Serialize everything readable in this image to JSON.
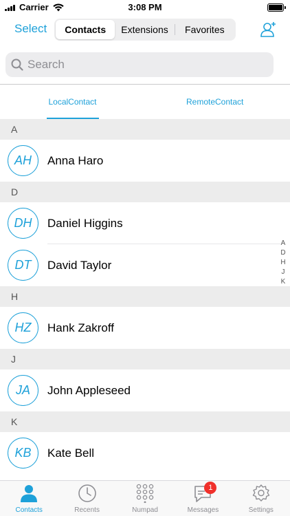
{
  "status_bar": {
    "carrier": "Carrier",
    "time": "3:08 PM"
  },
  "nav": {
    "select_label": "Select",
    "segments": [
      "Contacts",
      "Extensions",
      "Favorites"
    ],
    "active_segment": "Contacts",
    "add_contact_icon": "add-contact-icon"
  },
  "search": {
    "placeholder": "Search"
  },
  "sub_tabs": {
    "local": "LocalContact",
    "remote": "RemoteContact",
    "active": "LocalContact"
  },
  "sections": [
    {
      "letter": "A",
      "contacts": [
        {
          "initials": "AH",
          "name": "Anna Haro"
        }
      ]
    },
    {
      "letter": "D",
      "contacts": [
        {
          "initials": "DH",
          "name": "Daniel Higgins"
        },
        {
          "initials": "DT",
          "name": "David Taylor"
        }
      ]
    },
    {
      "letter": "H",
      "contacts": [
        {
          "initials": "HZ",
          "name": "Hank Zakroff"
        }
      ]
    },
    {
      "letter": "J",
      "contacts": [
        {
          "initials": "JA",
          "name": "John Appleseed"
        }
      ]
    },
    {
      "letter": "K",
      "contacts": [
        {
          "initials": "KB",
          "name": "Kate Bell"
        }
      ]
    }
  ],
  "index_letters": [
    "A",
    "D",
    "H",
    "J",
    "K"
  ],
  "tab_bar": {
    "tabs": [
      {
        "label": "Contacts",
        "icon": "person-icon"
      },
      {
        "label": "Recents",
        "icon": "clock-icon"
      },
      {
        "label": "Numpad",
        "icon": "keypad-icon"
      },
      {
        "label": "Messages",
        "icon": "message-icon",
        "badge": "1"
      },
      {
        "label": "Settings",
        "icon": "gear-icon"
      }
    ],
    "active": "Contacts"
  },
  "colors": {
    "accent": "#1ea1d9",
    "badge": "#f0302b",
    "section_bg": "#ececec"
  }
}
